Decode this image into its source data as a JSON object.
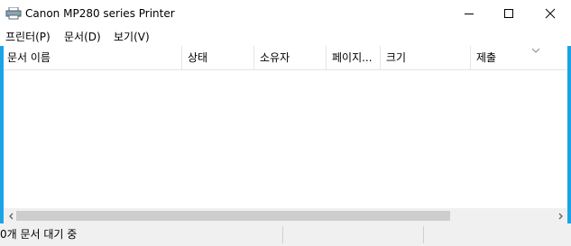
{
  "window": {
    "title": "Canon MP280 series Printer",
    "icon": "printer-icon"
  },
  "menu": [
    "프린터(P)",
    "문서(D)",
    "보기(V)"
  ],
  "columns": [
    "문서 이름",
    "상태",
    "소유자",
    "페이지...",
    "크기",
    "제출"
  ],
  "status": {
    "text": "0개 문서 대기 중"
  },
  "colors": {
    "frame_accent": "#1ba3e8",
    "scroll_thumb": "#cdcdcd",
    "status_bg": "#f0f0f0"
  }
}
